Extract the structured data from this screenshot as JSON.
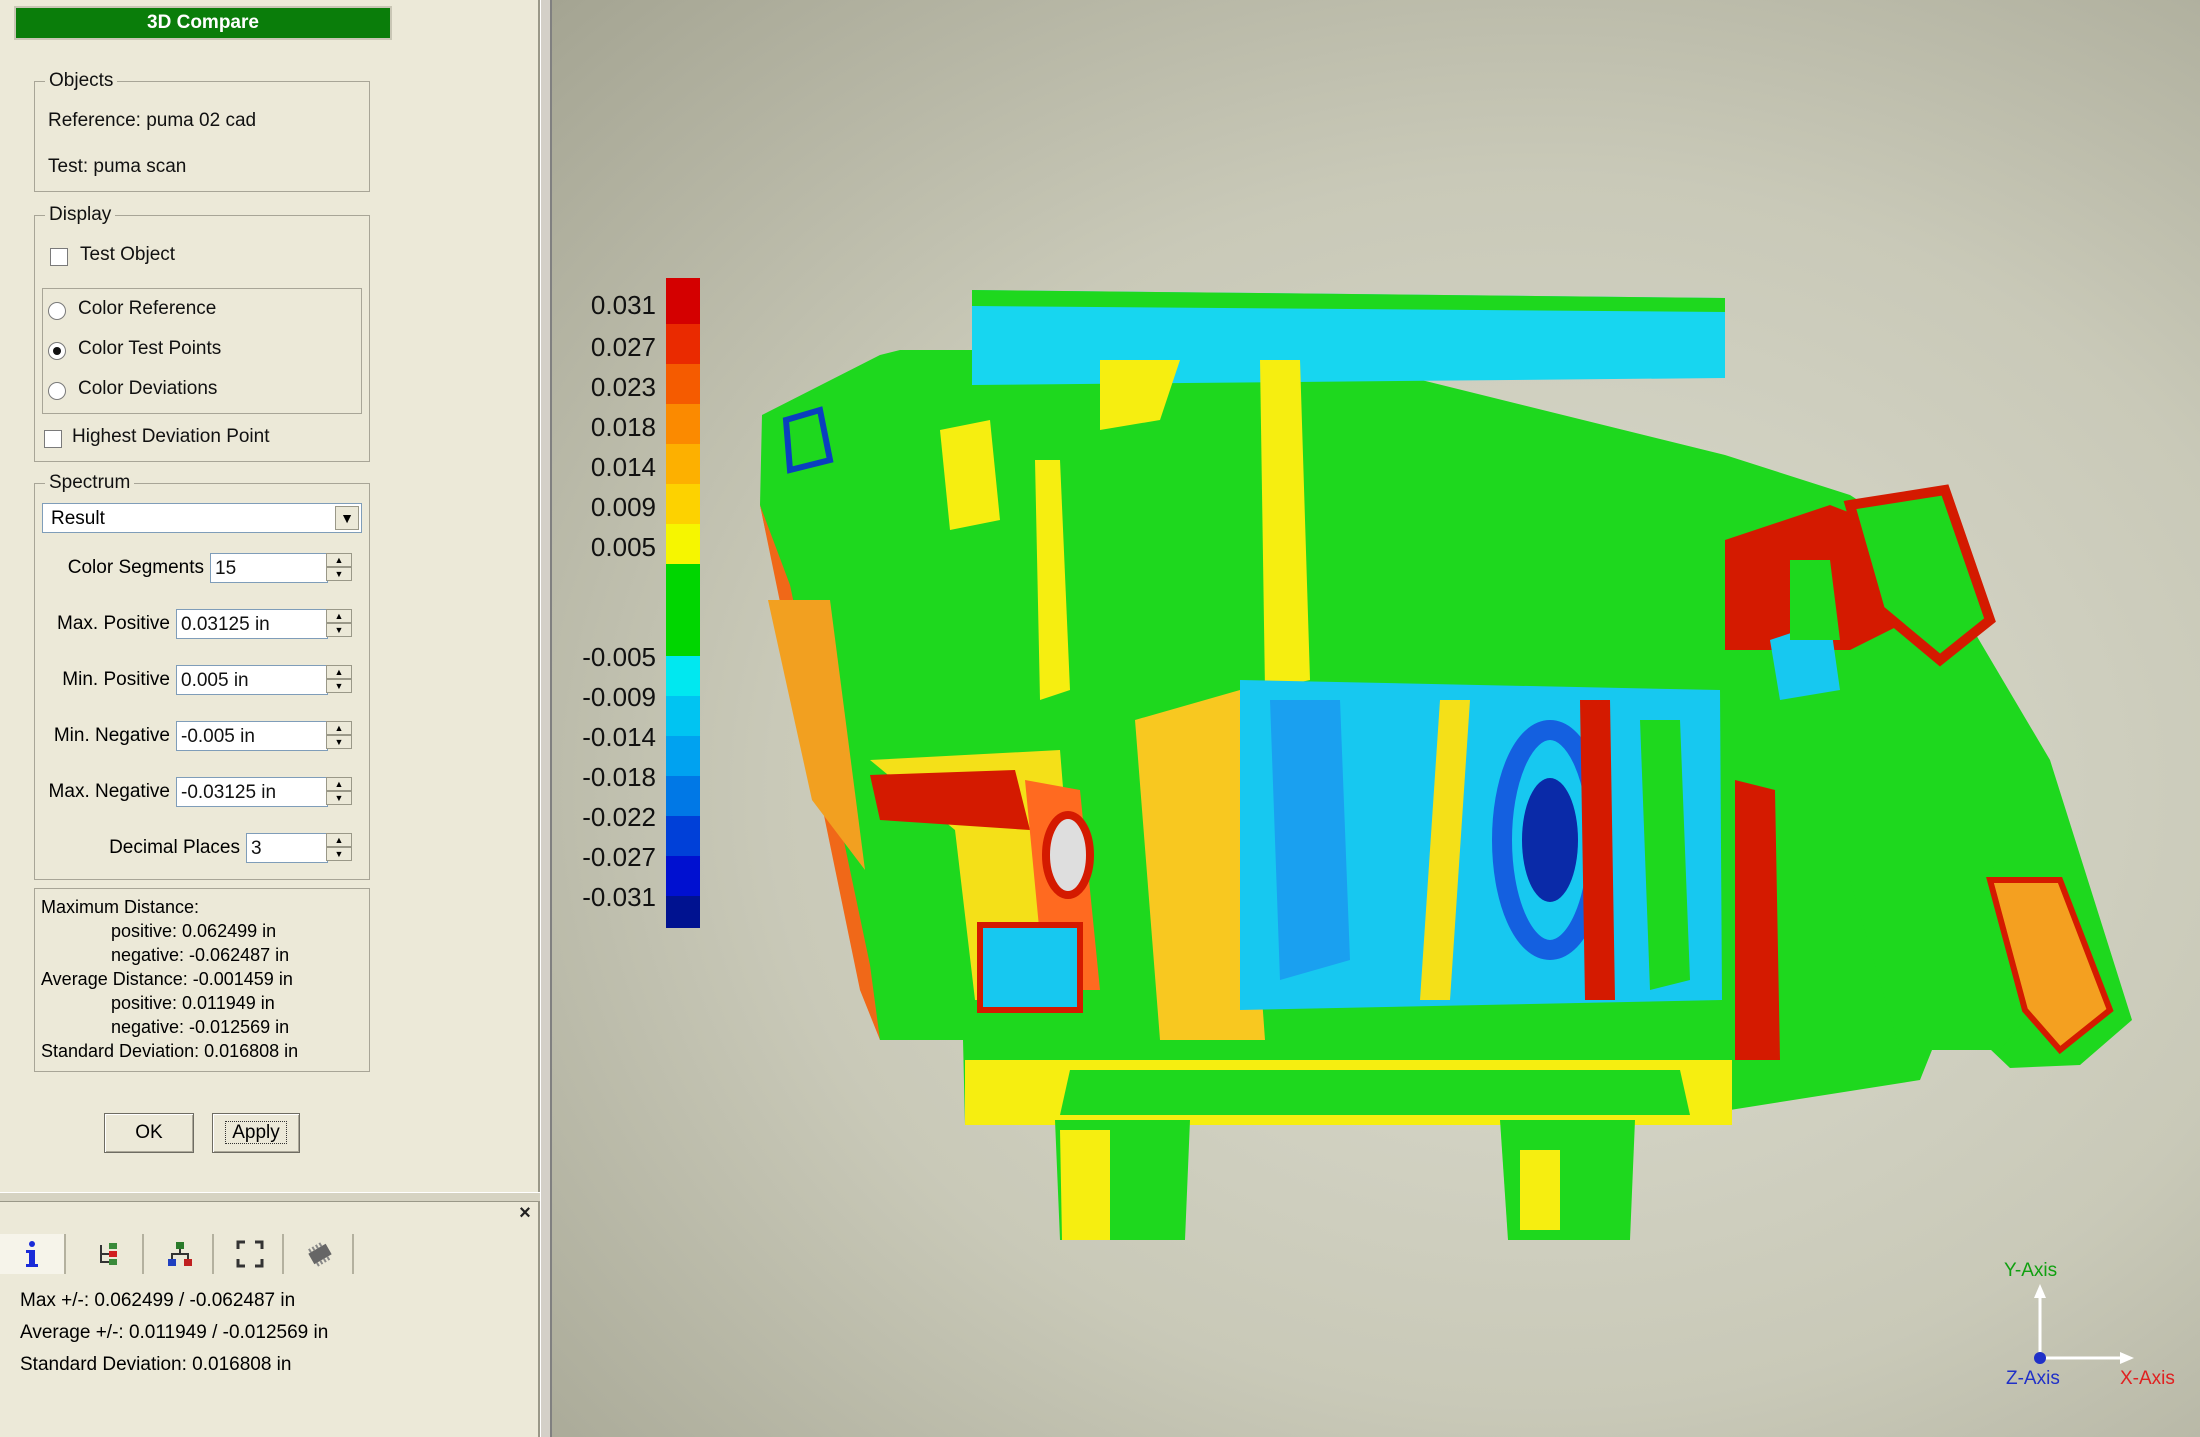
{
  "dialog": {
    "title": "3D Compare",
    "objects": {
      "legend": "Objects",
      "reference": "Reference: puma 02 cad",
      "test": "Test: puma scan"
    },
    "display": {
      "legend": "Display",
      "test_object": "Test Object",
      "test_object_checked": false,
      "radios": [
        {
          "label": "Color Reference",
          "selected": false
        },
        {
          "label": "Color Test Points",
          "selected": true
        },
        {
          "label": "Color Deviations",
          "selected": false
        }
      ],
      "highest_deviation_point": "Highest Deviation Point",
      "highest_deviation_checked": false
    },
    "spectrum": {
      "legend": "Spectrum",
      "selected": "Result",
      "fields": [
        {
          "label": "Color Segments",
          "value": "15"
        },
        {
          "label": "Max. Positive",
          "value": "0.03125 in"
        },
        {
          "label": "Min. Positive",
          "value": "0.005 in"
        },
        {
          "label": "Min. Negative",
          "value": "-0.005 in"
        },
        {
          "label": "Max. Negative",
          "value": "-0.03125 in"
        },
        {
          "label": "Decimal Places",
          "value": "3"
        }
      ]
    },
    "stats": [
      "Maximum Distance:",
      "positive: 0.062499 in",
      "negative: -0.062487 in",
      "Average Distance: -0.001459 in",
      "positive: 0.011949 in",
      "negative: -0.012569 in",
      "Standard Deviation: 0.016808 in"
    ],
    "ok_label": "OK",
    "apply_label": "Apply"
  },
  "bottom_panel": {
    "close_label": "×",
    "tabs": [
      {
        "icon": "info-icon",
        "active": true
      },
      {
        "icon": "tree-icon",
        "active": false
      },
      {
        "icon": "hierarchy-icon",
        "active": false
      },
      {
        "icon": "fullscreen-icon",
        "active": false
      },
      {
        "icon": "chip-icon",
        "active": false
      }
    ],
    "info_lines": [
      "Max +/-: 0.062499 / -0.062487 in",
      "Average +/-: 0.011949 / -0.012569 in",
      "Standard Deviation: 0.016808 in"
    ]
  },
  "legend_scale": {
    "labels": [
      "0.031",
      "0.027",
      "0.023",
      "0.018",
      "0.014",
      "0.009",
      "0.005",
      "-0.005",
      "-0.009",
      "-0.014",
      "-0.018",
      "-0.022",
      "-0.027",
      "-0.031"
    ],
    "colors": [
      "#d40000",
      "#ea2a00",
      "#f55b00",
      "#fb8a00",
      "#fdb000",
      "#fdd200",
      "#f6f600",
      "#00d600",
      "#00e8f0",
      "#00c4f2",
      "#00a2f0",
      "#0078e6",
      "#0040d8",
      "#0010d0",
      "#001290"
    ]
  },
  "axes": {
    "y": "Y-Axis",
    "z": "Z-Axis",
    "x": "X-Axis"
  },
  "colors": {
    "title_bar": "#0a7d0a",
    "viewport_bg": "#c9c9b8"
  }
}
